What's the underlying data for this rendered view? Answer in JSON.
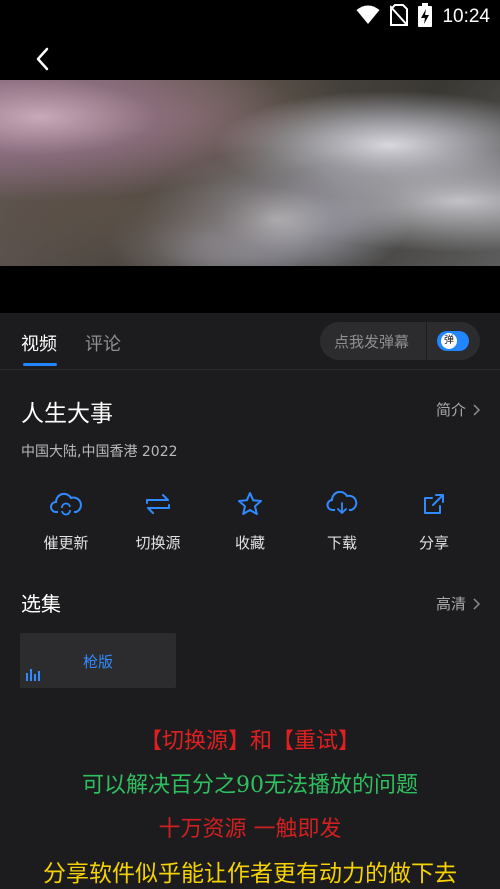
{
  "status": {
    "time": "10:24",
    "icons": [
      "wifi-icon",
      "no-sim-icon",
      "battery-charging-icon"
    ]
  },
  "nav": {
    "back_icon": "chevron-left-icon"
  },
  "tabs": [
    {
      "label": "视频",
      "active": true
    },
    {
      "label": "评论",
      "active": false
    }
  ],
  "danmu": {
    "placeholder": "点我发弹幕",
    "toggle_label": "弹",
    "toggle_on": true,
    "accent": "#1f86ff"
  },
  "movie": {
    "title": "人生大事",
    "intro_label": "简介",
    "meta": "中国大陆,中国香港   2022"
  },
  "actions": [
    {
      "icon": "cloud-refresh-icon",
      "label": "催更新"
    },
    {
      "icon": "swap-icon",
      "label": "切换源"
    },
    {
      "icon": "star-icon",
      "label": "收藏"
    },
    {
      "icon": "cloud-download-icon",
      "label": "下载"
    },
    {
      "icon": "share-icon",
      "label": "分享"
    }
  ],
  "episodes": {
    "title": "选集",
    "quality_label": "高清",
    "items": [
      {
        "label": "枪版",
        "playing": true
      }
    ]
  },
  "promo": {
    "line1": "【切换源】和【重试】",
    "line2": "可以解决百分之90无法播放的问题",
    "line3": "十万资源 一触即发",
    "line4": "分享软件似乎能让作者更有动力的做下去"
  },
  "colors": {
    "accent": "#1f86ff",
    "background": "#1c1c1e",
    "promo_red": "#e02020",
    "promo_green": "#2fbf5f",
    "promo_yellow": "#f5d200"
  }
}
